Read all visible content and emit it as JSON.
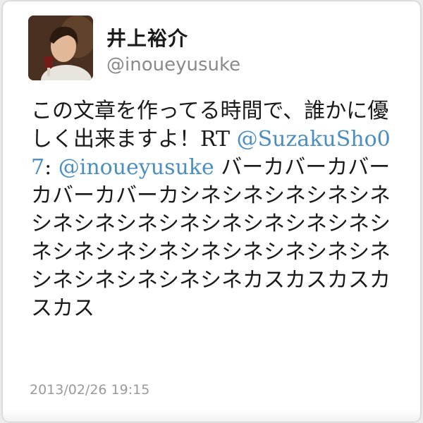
{
  "tweet": {
    "display_name": "井上裕介",
    "handle": "@inoueyusuke",
    "text_intro": "この文章を作ってる時間で、誰かに優しく出来ますよ！RT",
    "mention_1": "@SuzakuSho07",
    "colon": ":",
    "mention_2": "@inoueyusuke",
    "text_quote": "バーカバーカバーカバーカバーカシネシネシネシネシネシネシネシネシネシネシネシネシネシネシネシネシネシネシネシネシネシネシネシネシネシネシネカスカスカスカスカス",
    "timestamp": "2013/02/26 19:15"
  },
  "colors": {
    "mention": "#4a8ec2",
    "name": "#1a1a1a",
    "handle": "#8a8a8a",
    "timestamp": "#9a9a9a"
  },
  "icons": {
    "avatar": "user-avatar-photo"
  }
}
